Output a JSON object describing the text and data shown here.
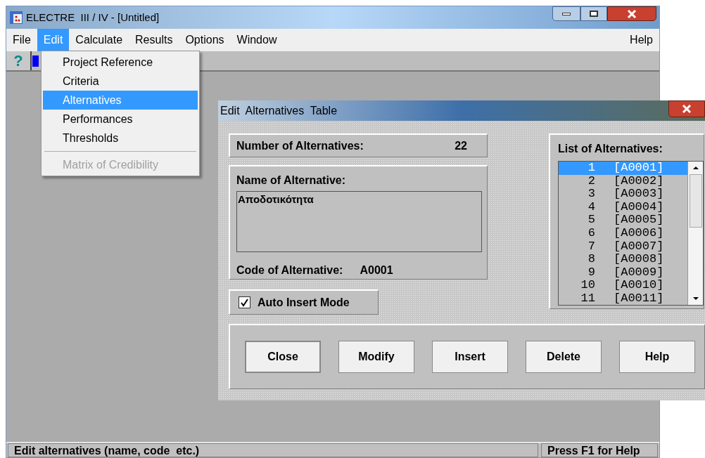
{
  "window": {
    "title": "ELECTRE  III / IV - [Untitled]"
  },
  "menu": [
    {
      "label": "File",
      "selected": false
    },
    {
      "label": "Edit",
      "selected": true
    },
    {
      "label": "Calculate",
      "selected": false
    },
    {
      "label": "Results",
      "selected": false
    },
    {
      "label": "Options",
      "selected": false
    },
    {
      "label": "Window",
      "selected": false
    }
  ],
  "help_menu": {
    "label": "Help",
    "selected": false
  },
  "toolbar": [
    {
      "label": "?"
    }
  ],
  "edit_menu": [
    {
      "label": "Project Reference",
      "selected": false,
      "disabled": false
    },
    {
      "label": "Criteria",
      "selected": false,
      "disabled": false
    },
    {
      "label": "Alternatives",
      "selected": true,
      "disabled": false
    },
    {
      "label": "Performances",
      "selected": false,
      "disabled": false
    },
    {
      "label": "Thresholds",
      "selected": false,
      "disabled": false
    },
    {
      "kind": "separator"
    },
    {
      "label": "Matrix of Credibility",
      "selected": false,
      "disabled": true
    }
  ],
  "dialog": {
    "title": "Edit  Alternatives  Table",
    "number_label": "Number of Alternatives:",
    "number_value": "22",
    "name_label": "Name of Alternative:",
    "name_value": "Αποδοτικότητα",
    "code_label": "Code of Alternative:",
    "code_value": "A0001",
    "auto_insert": {
      "label": "Auto Insert Mode",
      "checked": true
    },
    "list_label": "List of Alternatives:",
    "list": [
      {
        "number": "1",
        "code": "[A0001]",
        "selected": true
      },
      {
        "number": "2",
        "code": "[A0002]",
        "selected": false
      },
      {
        "number": "3",
        "code": "[A0003]",
        "selected": false
      },
      {
        "number": "4",
        "code": "[A0004]",
        "selected": false
      },
      {
        "number": "5",
        "code": "[A0005]",
        "selected": false
      },
      {
        "number": "6",
        "code": "[A0006]",
        "selected": false
      },
      {
        "number": "7",
        "code": "[A0007]",
        "selected": false
      },
      {
        "number": "8",
        "code": "[A0008]",
        "selected": false
      },
      {
        "number": "9",
        "code": "[A0009]",
        "selected": false
      },
      {
        "number": "10",
        "code": "[A0010]",
        "selected": false
      },
      {
        "number": "11",
        "code": "[A0011]",
        "selected": false
      }
    ],
    "buttons": [
      "Close",
      "Modify",
      "Insert",
      "Delete",
      "Help"
    ]
  },
  "status_bar": {
    "message": "Edit alternatives (name, code  etc.)",
    "hint": "Press F1 for Help"
  }
}
